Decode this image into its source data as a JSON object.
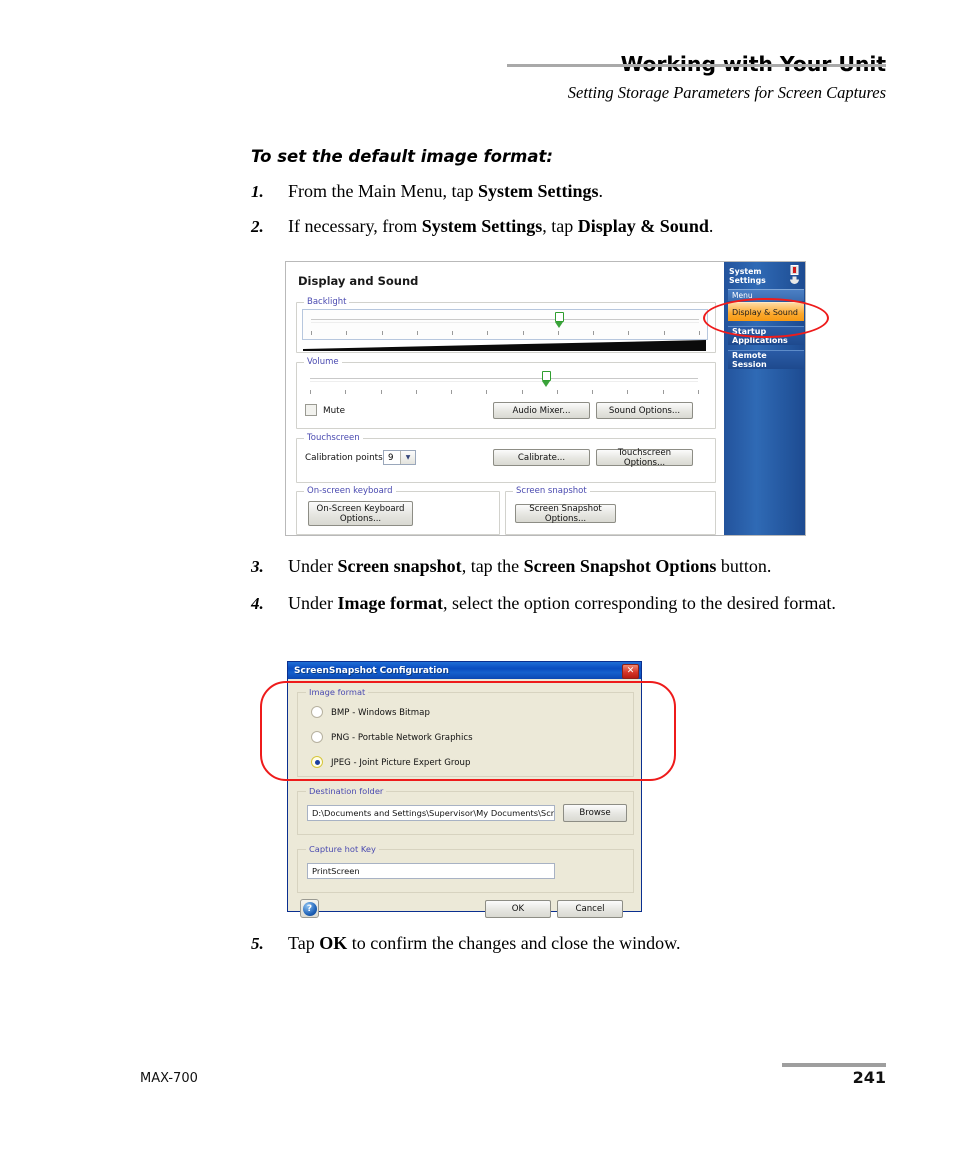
{
  "header": {
    "title": "Working with Your Unit",
    "subtitle": "Setting Storage Parameters for Screen Captures"
  },
  "section_title": "To set the default image format:",
  "steps": [
    {
      "num": "1.",
      "html": "From the Main Menu, tap <b>System Settings</b>."
    },
    {
      "num": "2.",
      "html": "If necessary, from <b>System Settings</b>, tap <b>Display &amp; Sound</b>."
    },
    {
      "num": "3.",
      "html": "Under <b>Screen snapshot</b>, tap the <b>Screen Snapshot Options</b> button."
    },
    {
      "num": "4.",
      "html": "Under <b>Image format</b>, select the option corresponding to the desired format."
    },
    {
      "num": "5.",
      "html": "Tap <b>OK</b> to confirm the changes and close the window."
    }
  ],
  "figure_display_sound": {
    "title": "Display and Sound",
    "backlight": {
      "label": "Backlight",
      "value_percent": 62
    },
    "volume": {
      "label": "Volume",
      "value_percent": 59
    },
    "mute": {
      "label": "Mute",
      "checked": false
    },
    "audio_mixer_button": "Audio Mixer...",
    "sound_options_button": "Sound Options...",
    "touchscreen": {
      "label": "Touchscreen",
      "calibration_label": "Calibration points:",
      "calibration_value": "9",
      "calibrate_button": "Calibrate...",
      "options_button": "Touchscreen Options..."
    },
    "onscreen_keyboard": {
      "label": "On-screen keyboard",
      "button": "On-Screen Keyboard Options..."
    },
    "screen_snapshot": {
      "label": "Screen snapshot",
      "button": "Screen Snapshot Options..."
    },
    "sidebar": {
      "title_line1": "System",
      "title_line2": "Settings",
      "menu_label": "Menu",
      "items": [
        {
          "label": "Display & Sound",
          "selected": true
        },
        {
          "label": "Startup Applications",
          "selected": false
        },
        {
          "label": "Remote Session",
          "selected": false
        }
      ]
    }
  },
  "figure_snapshot_dialog": {
    "title": "ScreenSnapshot Configuration",
    "close_glyph": "✕",
    "image_format": {
      "label": "Image format",
      "options": [
        {
          "label": "BMP - Windows Bitmap",
          "selected": false
        },
        {
          "label": "PNG - Portable Network Graphics",
          "selected": false
        },
        {
          "label": "JPEG - Joint Picture Expert Group",
          "selected": true
        }
      ]
    },
    "destination_folder": {
      "label": "Destination folder",
      "value": "D:\\Documents and Settings\\Supervisor\\My Documents\\Screen Snap",
      "browse_button": "Browse"
    },
    "capture_hot_key": {
      "label": "Capture hot Key",
      "value": "PrintScreen"
    },
    "help_glyph": "?",
    "ok_button": "OK",
    "cancel_button": "Cancel"
  },
  "footer": {
    "product": "MAX-700",
    "page_number": "241"
  },
  "colors": {
    "annotation_red": "#ee1b1b",
    "sidebar_blue": "#1d4b91",
    "selected_orange": "#fca82c",
    "titlebar_blue": "#0a4cc0"
  }
}
